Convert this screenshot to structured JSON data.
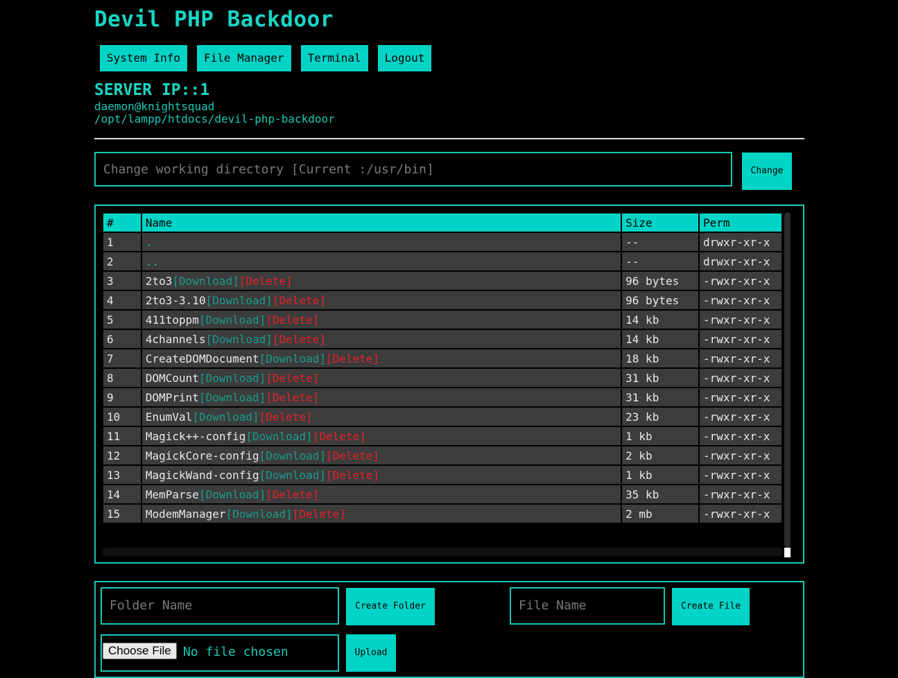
{
  "title": "Devil PHP Backdoor",
  "nav": [
    "System Info",
    "File Manager",
    "Terminal",
    "Logout"
  ],
  "server_ip": "SERVER IP::1",
  "user_host": "daemon@knightsquad",
  "path": "/opt/lampp/htdocs/devil-php-backdoor",
  "chdir": {
    "placeholder": "Change working directory [Current :/usr/bin]",
    "button": "Change"
  },
  "table": {
    "headers": [
      "#",
      "Name",
      "Size",
      "Perm"
    ],
    "download_label": "[Download]",
    "delete_label": "[Delete]",
    "rows": [
      {
        "n": "1",
        "name": ".",
        "size": "--",
        "perm": "drwxr-xr-x",
        "dir": true
      },
      {
        "n": "2",
        "name": "..",
        "size": "--",
        "perm": "drwxr-xr-x",
        "dir": true
      },
      {
        "n": "3",
        "name": "2to3",
        "size": "96 bytes",
        "perm": "-rwxr-xr-x"
      },
      {
        "n": "4",
        "name": "2to3-3.10",
        "size": "96 bytes",
        "perm": "-rwxr-xr-x"
      },
      {
        "n": "5",
        "name": "411toppm",
        "size": "14 kb",
        "perm": "-rwxr-xr-x"
      },
      {
        "n": "6",
        "name": "4channels",
        "size": "14 kb",
        "perm": "-rwxr-xr-x"
      },
      {
        "n": "7",
        "name": "CreateDOMDocument",
        "size": "18 kb",
        "perm": "-rwxr-xr-x"
      },
      {
        "n": "8",
        "name": "DOMCount",
        "size": "31 kb",
        "perm": "-rwxr-xr-x"
      },
      {
        "n": "9",
        "name": "DOMPrint",
        "size": "31 kb",
        "perm": "-rwxr-xr-x"
      },
      {
        "n": "10",
        "name": "EnumVal",
        "size": "23 kb",
        "perm": "-rwxr-xr-x"
      },
      {
        "n": "11",
        "name": "Magick++-config",
        "size": "1 kb",
        "perm": "-rwxr-xr-x"
      },
      {
        "n": "12",
        "name": "MagickCore-config",
        "size": "2 kb",
        "perm": "-rwxr-xr-x"
      },
      {
        "n": "13",
        "name": "MagickWand-config",
        "size": "1 kb",
        "perm": "-rwxr-xr-x"
      },
      {
        "n": "14",
        "name": "MemParse",
        "size": "35 kb",
        "perm": "-rwxr-xr-x"
      },
      {
        "n": "15",
        "name": "ModemManager",
        "size": "2 mb",
        "perm": "-rwxr-xr-x"
      }
    ]
  },
  "forms": {
    "folder_placeholder": "Folder Name",
    "create_folder": "Create Folder",
    "file_placeholder": "File Name",
    "create_file": "Create File",
    "choose_file": "Choose File",
    "no_file": "No file chosen",
    "upload": "Upload"
  }
}
